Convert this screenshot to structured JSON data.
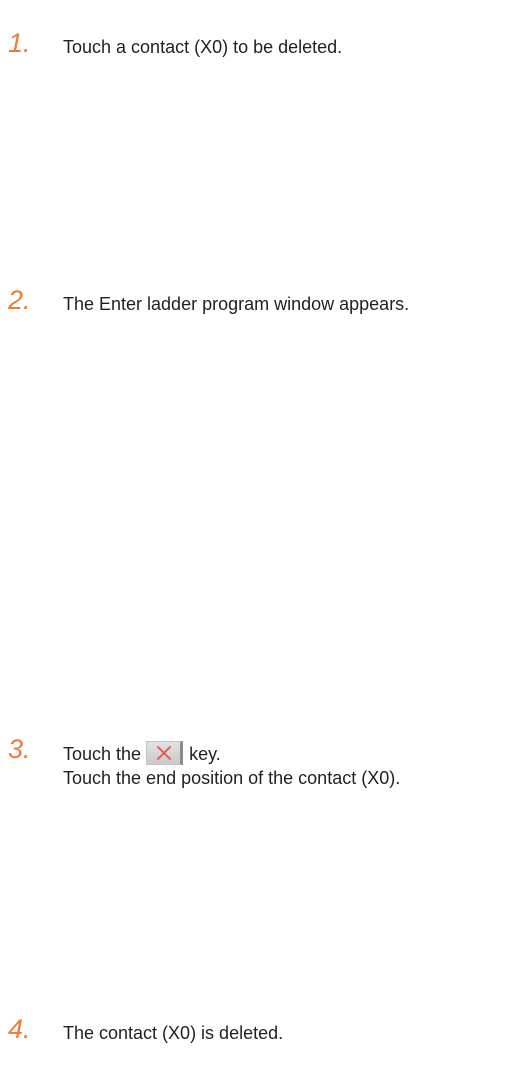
{
  "steps": [
    {
      "number": "1.",
      "text": "Touch a contact (X0) to be deleted."
    },
    {
      "number": "2.",
      "text": "The Enter ladder program window appears."
    },
    {
      "number": "3.",
      "line1_before": "Touch the",
      "key_icon": "delete-x-icon",
      "line1_after": "key.",
      "line2": "Touch the end position of the contact (X0)."
    },
    {
      "number": "4.",
      "text": "The contact (X0) is deleted."
    }
  ],
  "colors": {
    "step_number": "#ef7b3a",
    "body_text": "#231f20",
    "delete_x": "#e8534f"
  }
}
